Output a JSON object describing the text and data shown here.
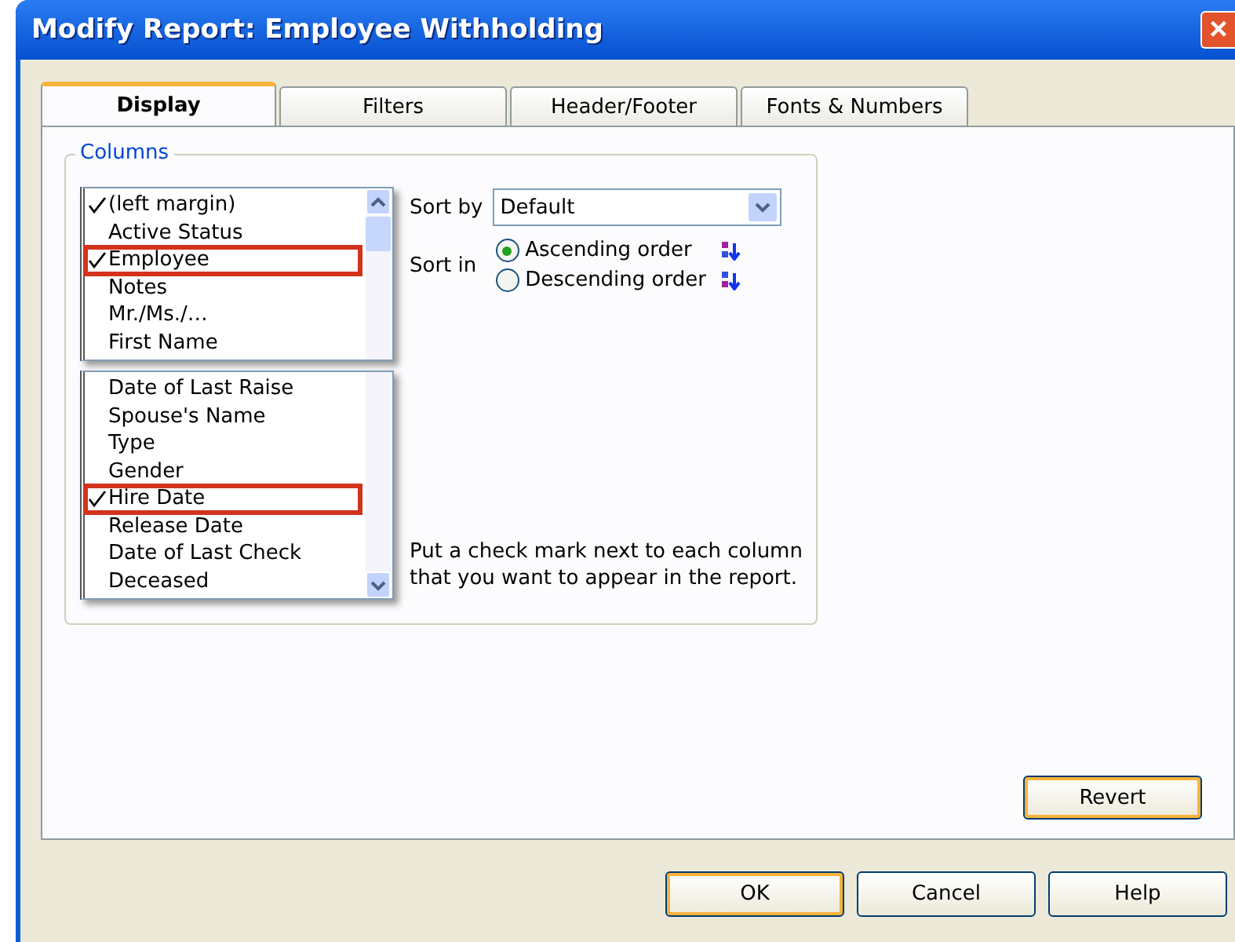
{
  "window": {
    "title": "Modify Report: Employee Withholding",
    "close": "×"
  },
  "tabs": [
    {
      "label": "Display",
      "selected": true
    },
    {
      "label": "Filters",
      "selected": false
    },
    {
      "label": "Header/Footer",
      "selected": false
    },
    {
      "label": "Fonts & Numbers",
      "selected": false
    }
  ],
  "columns_group": {
    "label": "Columns",
    "segments": [
      [
        {
          "label": "(left margin)",
          "checked": true,
          "highlighted": false
        },
        {
          "label": "Active Status",
          "checked": false,
          "highlighted": false
        },
        {
          "label": "Employee",
          "checked": true,
          "highlighted": true
        },
        {
          "label": "Notes",
          "checked": false,
          "highlighted": false
        },
        {
          "label": "Mr./Ms./…",
          "checked": false,
          "highlighted": false
        },
        {
          "label": "First Name",
          "checked": false,
          "highlighted": false
        }
      ],
      [
        {
          "label": "Date of Last Raise",
          "checked": false,
          "highlighted": false
        },
        {
          "label": "Spouse's Name",
          "checked": false,
          "highlighted": false
        },
        {
          "label": "Type",
          "checked": false,
          "highlighted": false
        },
        {
          "label": "Gender",
          "checked": false,
          "highlighted": false
        },
        {
          "label": "Hire Date",
          "checked": true,
          "highlighted": true
        },
        {
          "label": "Release Date",
          "checked": false,
          "highlighted": false
        },
        {
          "label": "Date of Last Check",
          "checked": false,
          "highlighted": false
        },
        {
          "label": "Deceased",
          "checked": false,
          "highlighted": false
        }
      ]
    ],
    "sort_by_label": "Sort by",
    "sort_by_value": "Default",
    "sort_in_label": "Sort in",
    "sort_options": [
      {
        "label": "Ascending order",
        "selected": true,
        "kind": "ascending"
      },
      {
        "label": "Descending order",
        "selected": false,
        "kind": "descending"
      }
    ],
    "hint": "Put a check mark next to each column that you want to appear in the report."
  },
  "revert_button": "Revert",
  "buttons": [
    "OK",
    "Cancel",
    "Help"
  ]
}
